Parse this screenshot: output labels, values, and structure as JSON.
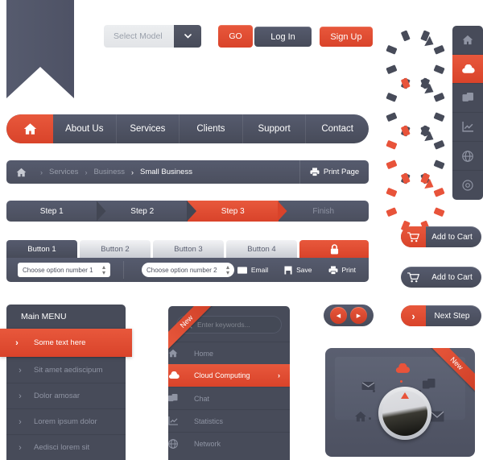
{
  "selector": {
    "value": "Select Model",
    "dropdown_icon": "chevron-down-icon",
    "go_label": "GO"
  },
  "auth": {
    "login_label": "Log In",
    "signup_label": "Sign Up"
  },
  "spinners": {
    "icon": "loading-spinner-icon",
    "segments": 8,
    "states": [
      0,
      1,
      3,
      8
    ]
  },
  "icon_strip": {
    "items": [
      {
        "name": "home-icon",
        "label": "Home",
        "active": false
      },
      {
        "name": "cloud-icon",
        "label": "Cloud",
        "active": true
      },
      {
        "name": "windows-icon",
        "label": "Chat",
        "active": false
      },
      {
        "name": "chart-icon",
        "label": "Statistics",
        "active": false
      },
      {
        "name": "globe-icon",
        "label": "Network",
        "active": false
      },
      {
        "name": "gear-icon",
        "label": "Settings",
        "active": false
      }
    ]
  },
  "main_nav": {
    "home_icon": "home-icon",
    "items": [
      "About Us",
      "Services",
      "Clients",
      "Support",
      "Contact"
    ]
  },
  "breadcrumb": {
    "home_icon": "home-icon",
    "separator": "›",
    "items": [
      {
        "label": "Services",
        "current": false
      },
      {
        "label": "Business",
        "current": false
      },
      {
        "label": "Small Business",
        "current": true
      }
    ],
    "print_label": "Print Page",
    "print_icon": "printer-icon"
  },
  "steps": {
    "items": [
      {
        "label": "Step 1",
        "state": "done"
      },
      {
        "label": "Step 2",
        "state": "done"
      },
      {
        "label": "Step 3",
        "state": "active"
      },
      {
        "label": "Finish",
        "state": "disabled"
      }
    ]
  },
  "tab_panel": {
    "tabs": [
      {
        "label": "Button 1",
        "active": true
      },
      {
        "label": "Button 2",
        "active": false
      },
      {
        "label": "Button 3",
        "active": false
      },
      {
        "label": "Button 4",
        "active": false
      }
    ],
    "lock_tab": {
      "icon": "lock-icon",
      "label": ""
    },
    "select_one": "Choose option number 1",
    "select_two": "Choose option number 2",
    "actions": [
      {
        "label": "Email",
        "icon": "envelope-icon"
      },
      {
        "label": "Save",
        "icon": "save-icon"
      },
      {
        "label": "Print",
        "icon": "printer-icon"
      }
    ]
  },
  "left_menu": {
    "title": "Main  MENU",
    "items": [
      {
        "label": "Some text here",
        "active": true
      },
      {
        "label": "Sit amet aediscipum",
        "active": false
      },
      {
        "label": "Dolor amosar",
        "active": false
      },
      {
        "label": "Lorem ipsum dolor",
        "active": false
      },
      {
        "label": "Aedisci lorem sit",
        "active": false
      }
    ],
    "chevron_icon": "chevron-right-icon"
  },
  "mid_panel": {
    "ribbon_label": "New",
    "search_placeholder": "Enter keywords...",
    "search_icon": "search-icon",
    "items": [
      {
        "label": "Home",
        "icon": "home-icon",
        "active": false
      },
      {
        "label": "Cloud Computing",
        "icon": "cloud-icon",
        "active": true
      },
      {
        "label": "Chat",
        "icon": "windows-icon",
        "active": false
      },
      {
        "label": "Statistics",
        "icon": "chart-icon",
        "active": false
      },
      {
        "label": "Network",
        "icon": "globe-icon",
        "active": false
      }
    ]
  },
  "cart_buttons": [
    {
      "label": "Add to Cart",
      "icon": "cart-icon",
      "style": "split"
    },
    {
      "label": "Add to Cart",
      "icon": "cart-icon",
      "style": "flat"
    }
  ],
  "next_step_button": {
    "label": "Next Step",
    "icon": "chevron-right-icon"
  },
  "pager": {
    "prev_icon": "triangle-left-icon",
    "next_icon": "triangle-right-icon"
  },
  "device": {
    "ribbon_label": "New",
    "cloud_icon": "cloud-icon",
    "icons": [
      "mail-open-icon",
      "windows-icon",
      "home-icon",
      "envelope-icon"
    ],
    "knob_icon": "knob-dial"
  },
  "colors": {
    "accent": "#e8533a",
    "accent_dark": "#d9432a",
    "dark": "#474b59",
    "dark_light": "#565b6e",
    "muted_text": "#8f94a3",
    "light_grey": "#e2e4e7"
  }
}
